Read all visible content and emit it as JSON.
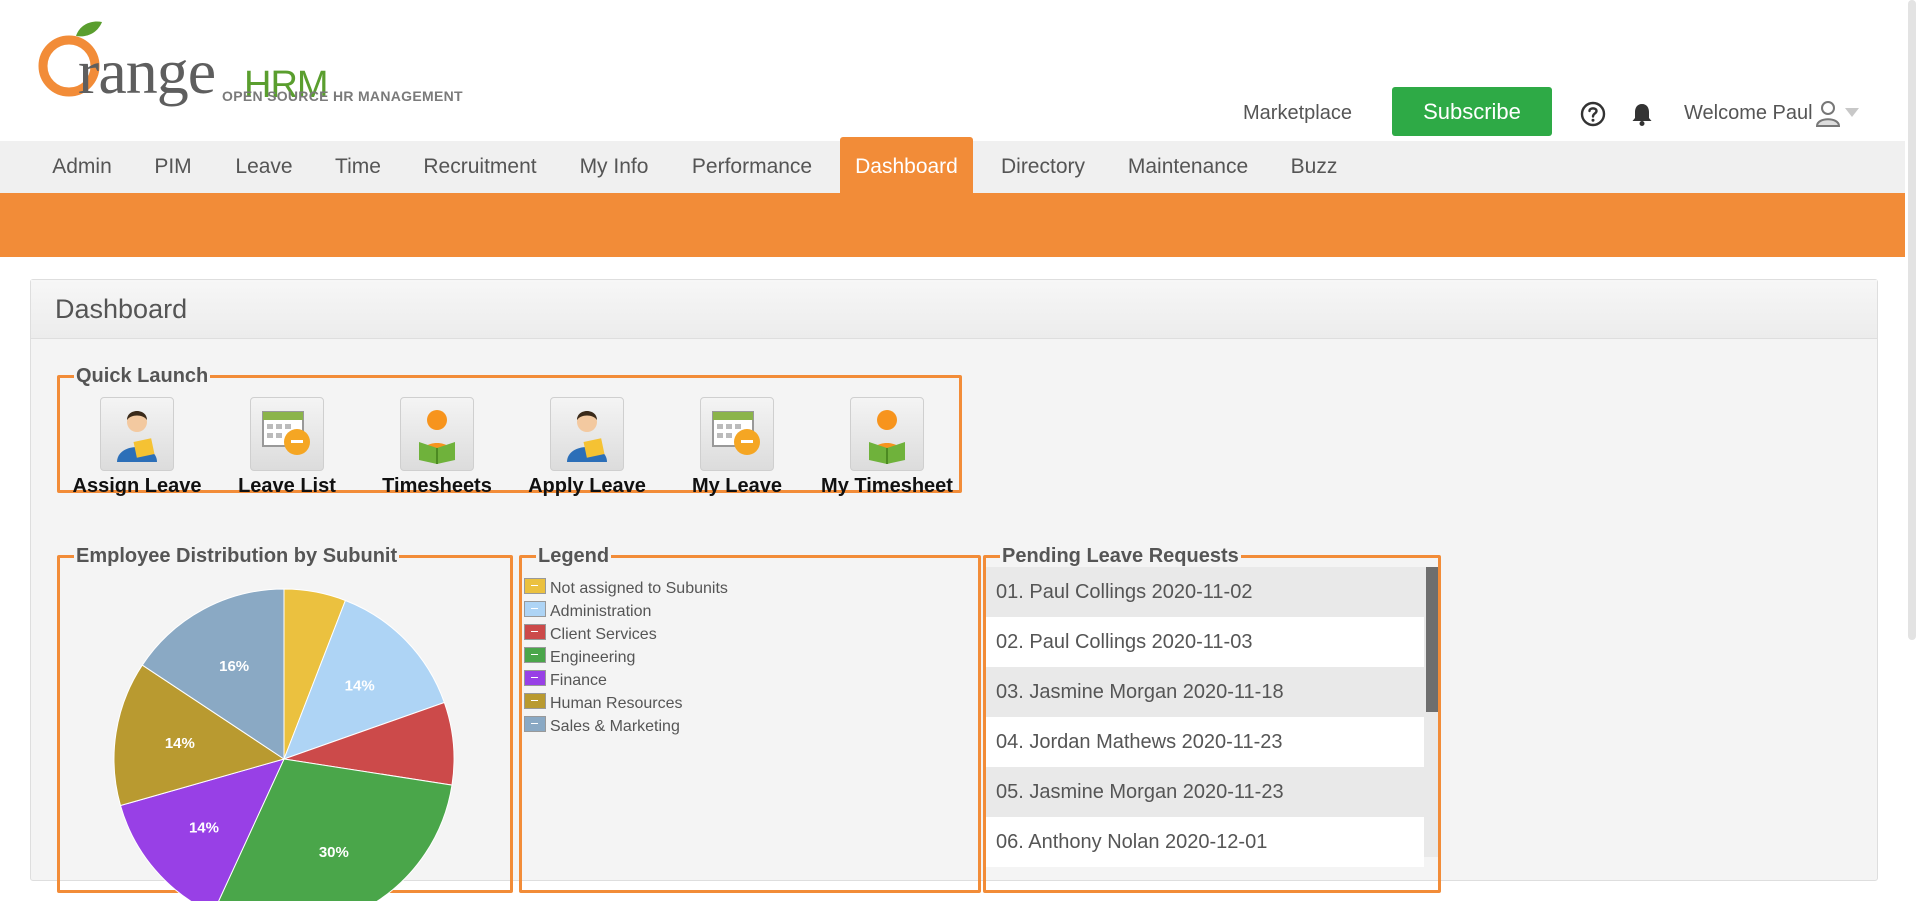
{
  "header": {
    "logo_brand": "range",
    "logo_hrm": "HRM",
    "logo_tagline": "OPEN SOURCE HR MANAGEMENT",
    "marketplace": "Marketplace",
    "subscribe": "Subscribe",
    "welcome": "Welcome Paul"
  },
  "menu": {
    "items": [
      "Admin",
      "PIM",
      "Leave",
      "Time",
      "Recruitment",
      "My Info",
      "Performance",
      "Dashboard",
      "Directory",
      "Maintenance",
      "Buzz"
    ],
    "active": "Dashboard"
  },
  "colors": {
    "accent": "#f28c38",
    "subscribe": "#2eaa46"
  },
  "dashboard": {
    "title": "Dashboard",
    "quick_launch": {
      "title": "Quick Launch",
      "items": [
        {
          "label": "Assign Leave",
          "icon": "assign-leave-icon"
        },
        {
          "label": "Leave List",
          "icon": "leave-list-icon"
        },
        {
          "label": "Timesheets",
          "icon": "timesheets-icon"
        },
        {
          "label": "Apply Leave",
          "icon": "apply-leave-icon"
        },
        {
          "label": "My Leave",
          "icon": "my-leave-icon"
        },
        {
          "label": "My Timesheet",
          "icon": "my-timesheet-icon"
        }
      ]
    },
    "distribution": {
      "title": "Employee Distribution by Subunit"
    },
    "legend": {
      "title": "Legend"
    },
    "pending": {
      "title": "Pending Leave Requests",
      "items": [
        "01. Paul Collings 2020-11-02",
        "02. Paul Collings 2020-11-03",
        "03. Jasmine Morgan 2020-11-18",
        "04. Jordan Mathews 2020-11-23",
        "05. Jasmine Morgan 2020-11-23",
        "06. Anthony Nolan 2020-12-01"
      ]
    }
  },
  "chart_data": {
    "type": "pie",
    "categories": [
      "Not assigned to Subunits",
      "Administration",
      "Client Services",
      "Engineering",
      "Finance",
      "Human Resources",
      "Sales & Marketing"
    ],
    "values": [
      6,
      14,
      8,
      30,
      14,
      14,
      16
    ],
    "labels": [
      "",
      "14%",
      "",
      "30%",
      "14%",
      "14%",
      "16%"
    ],
    "colors": [
      "#ebc13f",
      "#aed4f5",
      "#cc4a4a",
      "#4aa64a",
      "#9840e6",
      "#b99a30",
      "#8aa9c4"
    ]
  }
}
